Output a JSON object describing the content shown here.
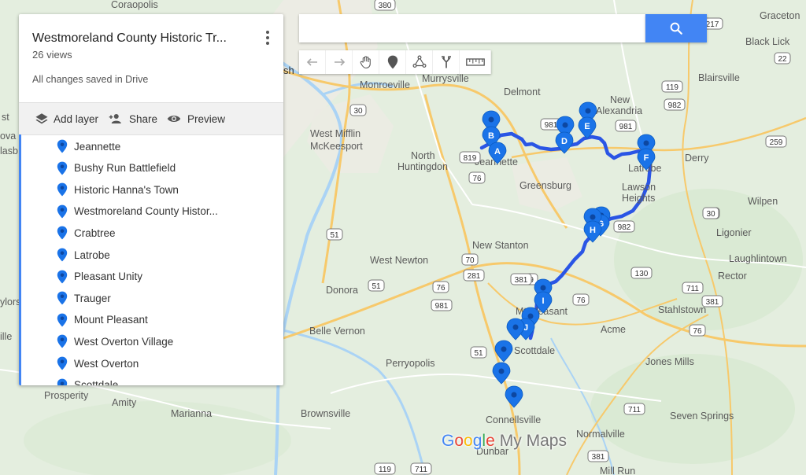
{
  "map_title": "Westmoreland County Historic Tr...",
  "views": "26 views",
  "save_status": "All changes saved in Drive",
  "toolbar": {
    "add_layer": "Add layer",
    "share": "Share",
    "preview": "Preview"
  },
  "search": {
    "placeholder": ""
  },
  "locations": [
    "Jeannette",
    "Bushy Run Battlefield",
    "Historic Hanna's Town",
    "Westmoreland County Histor...",
    "Crabtree",
    "Latrobe",
    "Pleasant Unity",
    "Trauger",
    "Mount Pleasant",
    "West Overton Village",
    "West Overton",
    "Scottdale"
  ],
  "pin_letters": [
    "A",
    "B",
    "C",
    "D",
    "E",
    "F",
    "G",
    "H",
    "I",
    "J"
  ],
  "route_color": "#2a55e5",
  "pin_color": "#1a73e8",
  "brand": {
    "google": "Google",
    "my_maps": "My Maps"
  },
  "places": {
    "coraopolis": "Coraopolis",
    "graceton": "Graceton",
    "black_lick": "Black Lick",
    "blairsville": "Blairsville",
    "monroeville": "Monroeville",
    "murrysville": "Murrysville",
    "delmont": "Delmont",
    "new_alexandria": "New\nAlexandria",
    "derry": "Derry",
    "west_mifflin": "West Mifflin",
    "mckeesport": "McKeesport",
    "north_huntingdon": "North\nHuntingdon",
    "jeannette": "Jeannette",
    "greensburg": "Greensburg",
    "latrobe": "Latrobe",
    "lawson_heights": "Lawson\nHeights",
    "wilpen": "Wilpen",
    "ligonier": "Ligonier",
    "laughlintown": "Laughlintown",
    "rector": "Rector",
    "west_newton": "West Newton",
    "new_stanton": "New Stanton",
    "donora": "Donora",
    "mt_pleasant": "Mt Pleasant",
    "stahlstown": "Stahlstown",
    "belle_vernon": "Belle Vernon",
    "acme": "Acme",
    "scottdale": "Scottdale",
    "perryopolis": "Perryopolis",
    "jones_mills": "Jones Mills",
    "prosperity": "Prosperity",
    "amity": "Amity",
    "marianna": "Marianna",
    "brownsville": "Brownsville",
    "connellsville": "Connellsville",
    "normalville": "Normalville",
    "seven_springs": "Seven Springs",
    "dunbar": "Dunbar",
    "mill_run": "Mill Run",
    "edge_sh": "sh",
    "edge_st": "st",
    "edge_ova": "ova",
    "edge_lasb": "lasb",
    "edge_ylors": "ylors",
    "edge_ille": "ille"
  },
  "road_shields": [
    "380",
    "217",
    "22",
    "119",
    "982",
    "981",
    "30",
    "259",
    "30",
    "76",
    "981",
    "819",
    "30",
    "76",
    "982",
    "30",
    "51",
    "70",
    "130",
    "711",
    "381",
    "51",
    "981",
    "119",
    "76",
    "76",
    "711",
    "381",
    "711",
    "119",
    "381",
    "281",
    "51"
  ]
}
